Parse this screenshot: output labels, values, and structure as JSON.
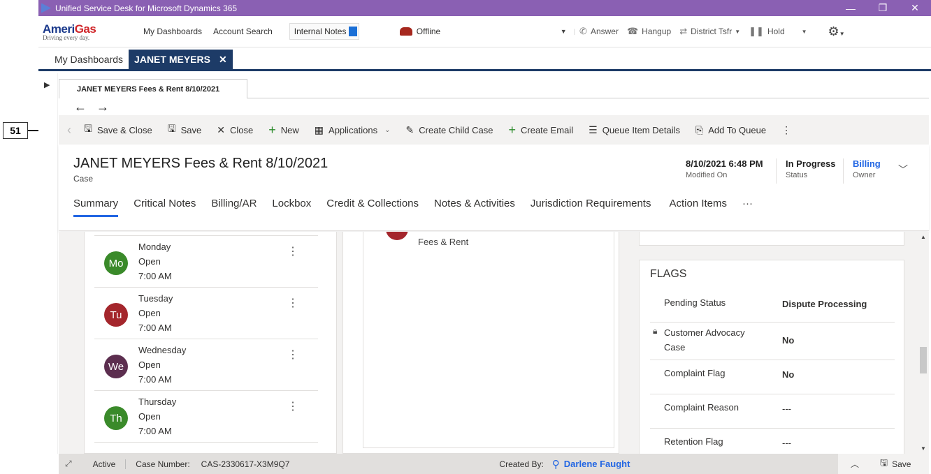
{
  "callout": {
    "number": "51"
  },
  "titlebar": {
    "title": "Unified Service Desk for Microsoft Dynamics 365",
    "minimize": "—",
    "restore": "❐",
    "close": "✕"
  },
  "brand": {
    "name_blue": "Ameri",
    "name_red": "Gas",
    "tagline": "Driving every day."
  },
  "toolbar": {
    "my_dashboards": "My Dashboards",
    "account_search": "Account Search",
    "internal_notes": "Internal Notes",
    "status": "Offline",
    "answer": "Answer",
    "hangup": "Hangup",
    "district_tsfr": "District Tsfr",
    "hold": "Hold"
  },
  "session_tabs": [
    {
      "label": "My Dashboards"
    },
    {
      "label": "JANET MEYERS",
      "close": "✕"
    }
  ],
  "inner_tab": {
    "label": "JANET MEYERS  Fees & Rent 8/10/2021"
  },
  "commands": {
    "save_close": "Save & Close",
    "save": "Save",
    "close": "Close",
    "new": "New",
    "applications": "Applications",
    "create_child_case": "Create Child Case",
    "create_email": "Create Email",
    "queue_item_details": "Queue Item Details",
    "add_to_queue": "Add To Queue"
  },
  "record": {
    "title": "JANET MEYERS  Fees & Rent 8/10/2021",
    "entity": "Case",
    "modified_on": {
      "value": "8/10/2021 6:48 PM",
      "label": "Modified On"
    },
    "status": {
      "value": "In Progress",
      "label": "Status"
    },
    "owner": {
      "value": "Billing",
      "label": "Owner"
    }
  },
  "record_tabs": [
    "Summary",
    "Critical Notes",
    "Billing/AR",
    "Lockbox",
    "Credit & Collections",
    "Notes & Activities",
    "Jurisdiction Requirements",
    "Action Items",
    "···"
  ],
  "schedule": [
    {
      "initials": "Mo",
      "day": "Monday",
      "state": "Open",
      "time": "7:00 AM",
      "color": "#3a8a2a"
    },
    {
      "initials": "Tu",
      "day": "Tuesday",
      "state": "Open",
      "time": "7:00 AM",
      "color": "#a4262c"
    },
    {
      "initials": "We",
      "day": "Wednesday",
      "state": "Open",
      "time": "7:00 AM",
      "color": "#5c2e4f"
    },
    {
      "initials": "Th",
      "day": "Thursday",
      "state": "Open",
      "time": "7:00 AM",
      "color": "#3a8a2a"
    }
  ],
  "timeline": {
    "item": "Fees & Rent"
  },
  "flags": {
    "title": "FLAGS",
    "rows": [
      {
        "label": "Pending Status",
        "value": "Dispute Processing"
      },
      {
        "label": "Customer Advocacy Case",
        "value": "No"
      },
      {
        "label": "Complaint Flag",
        "value": "No"
      },
      {
        "label": "Complaint Reason",
        "value": "---"
      },
      {
        "label": "Retention Flag",
        "value": "---"
      }
    ]
  },
  "footer": {
    "state": "Active",
    "case_number_label": "Case Number:",
    "case_number": "CAS-2330617-X3M9Q7",
    "created_by_label": "Created By:",
    "created_by": "Darlene Faught",
    "save": "Save"
  }
}
